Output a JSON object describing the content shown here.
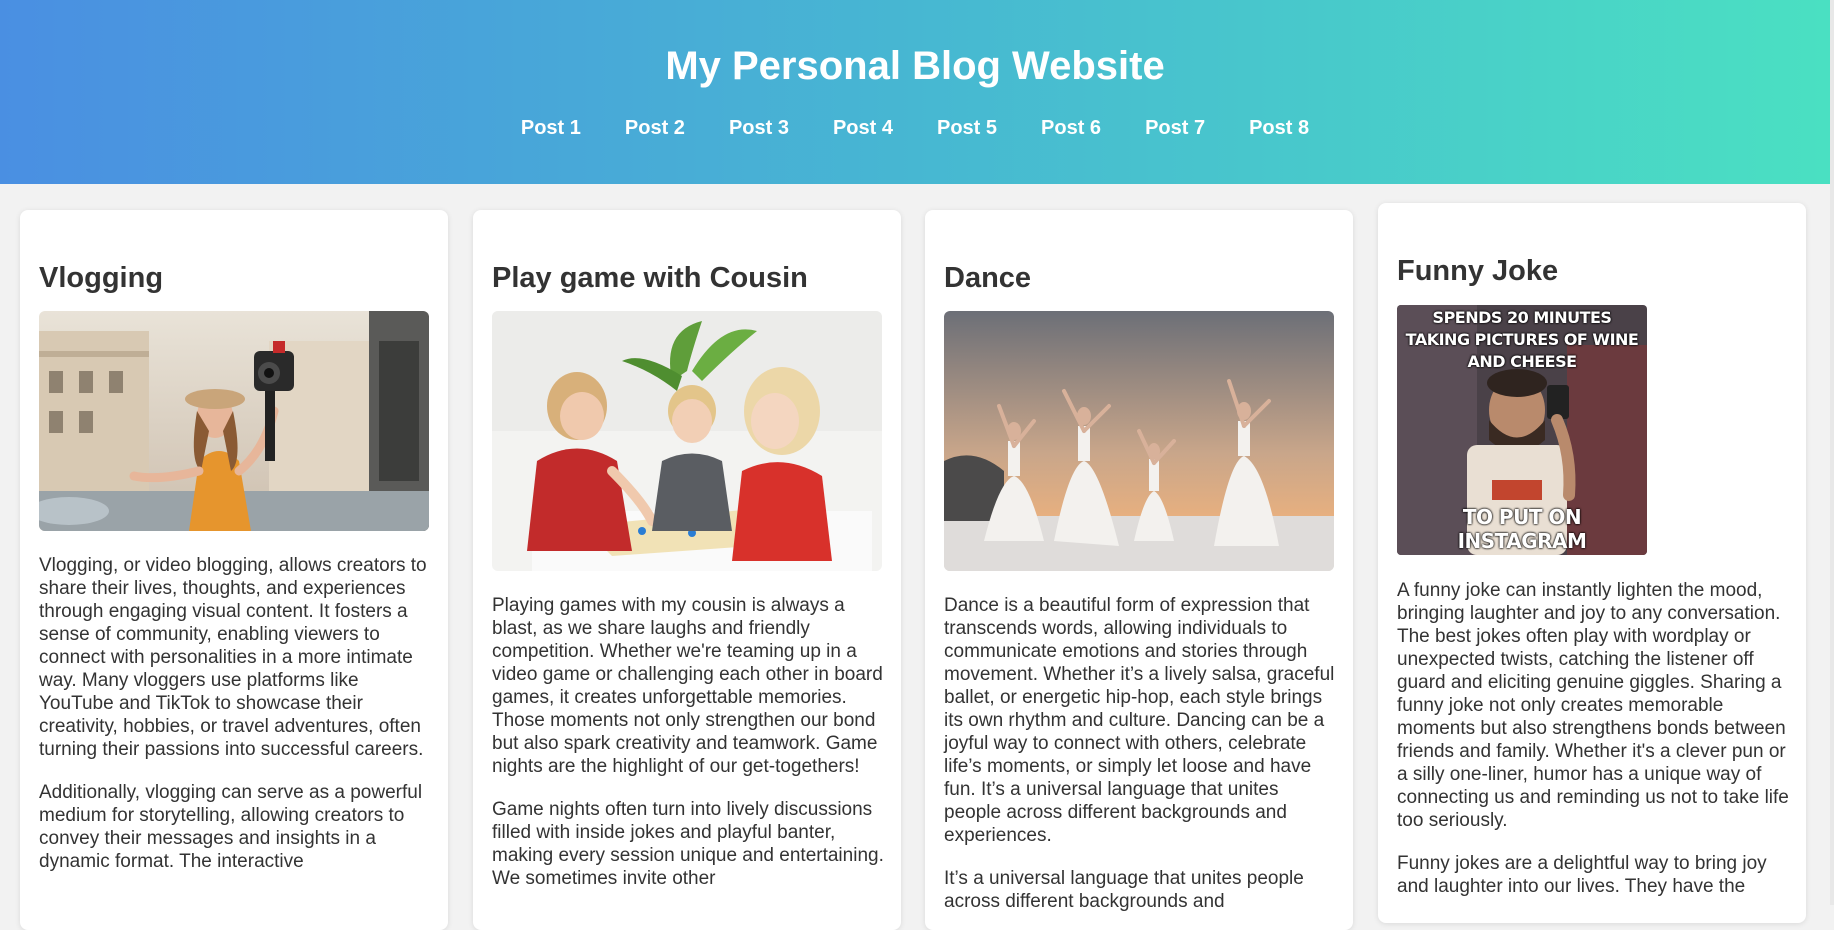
{
  "site": {
    "title": "My Personal Blog Website",
    "nav": [
      "Post 1",
      "Post 2",
      "Post 3",
      "Post 4",
      "Post 5",
      "Post 6",
      "Post 7",
      "Post 8"
    ]
  },
  "posts": [
    {
      "title": "Vlogging",
      "image_alt": "Woman vlogging with a camera on a city street",
      "paragraphs": [
        "Vlogging, or video blogging, allows creators to share their lives, thoughts, and experiences through engaging visual content. It fosters a sense of community, enabling viewers to connect with personalities in a more intimate way. Many vloggers use platforms like YouTube and TikTok to showcase their creativity, hobbies, or travel adventures, often turning their passions into successful careers.",
        "Additionally, vlogging can serve as a powerful medium for storytelling, allowing creators to convey their messages and insights in a dynamic format. The interactive"
      ]
    },
    {
      "title": "Play game with Cousin",
      "image_alt": "Three children playing a board game",
      "paragraphs": [
        "Playing games with my cousin is always a blast, as we share laughs and friendly competition. Whether we're teaming up in a video game or challenging each other in board games, it creates unforgettable memories. Those moments not only strengthen our bond but also spark creativity and teamwork. Game nights are the highlight of our get-togethers!",
        "Game nights often turn into lively discussions filled with inside jokes and playful banter, making every session unique and entertaining. We sometimes invite other"
      ]
    },
    {
      "title": "Dance",
      "image_alt": "Ballet dancers performing on a stage at sunset",
      "paragraphs": [
        "Dance is a beautiful form of expression that transcends words, allowing individuals to communicate emotions and stories through movement. Whether it’s a lively salsa, graceful ballet, or energetic hip-hop, each style brings its own rhythm and culture. Dancing can be a joyful way to connect with others, celebrate life’s moments, or simply let loose and have fun. It’s a universal language that unites people across different backgrounds and experiences.",
        "It’s a universal language that unites people across different backgrounds and"
      ]
    },
    {
      "title": "Funny Joke",
      "image_alt": "Meme of a man taking a mirror selfie",
      "meme_top": "SPENDS 20 MINUTES TAKING PICTURES OF WINE AND CHEESE",
      "meme_bottom": "TO PUT ON INSTAGRAM",
      "paragraphs": [
        "A funny joke can instantly lighten the mood, bringing laughter and joy to any conversation. The best jokes often play with wordplay or unexpected twists, catching the listener off guard and eliciting genuine giggles. Sharing a funny joke not only creates memorable moments but also strengthens bonds between friends and family. Whether it's a clever pun or a silly one-liner, humor has a unique way of connecting us and reminding us not to take life too seriously.",
        "Funny jokes are a delightful way to bring joy and laughter into our lives. They have the"
      ]
    }
  ]
}
